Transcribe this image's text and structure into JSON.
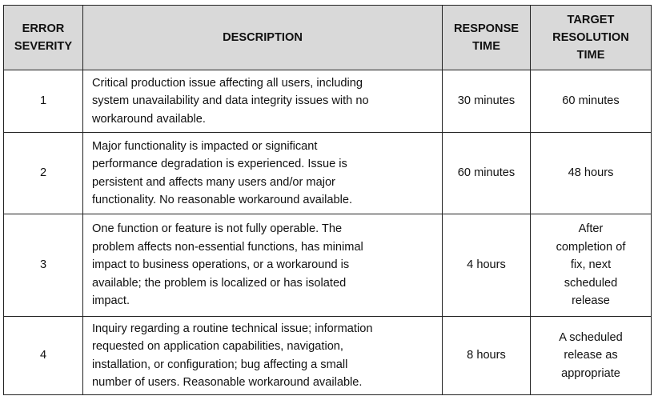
{
  "headers": {
    "severity": [
      "ERROR",
      "SEVERITY"
    ],
    "description": "DESCRIPTION",
    "response": [
      "RESPONSE",
      "TIME"
    ],
    "target": [
      "TARGET",
      "RESOLUTION",
      "TIME"
    ]
  },
  "rows": [
    {
      "severity": "1",
      "description": [
        "Critical production issue affecting all users, including",
        "system unavailability and data integrity issues with no",
        "workaround available."
      ],
      "response": "30 minutes",
      "target": [
        "60 minutes"
      ]
    },
    {
      "severity": "2",
      "description": [
        "Major functionality is impacted or significant",
        "performance degradation is experienced.  Issue is",
        "persistent and affects many users and/or major",
        "functionality.  No reasonable workaround available."
      ],
      "response": "60 minutes",
      "target": [
        "48 hours"
      ]
    },
    {
      "severity": "3",
      "description": [
        "One function or feature is not fully operable. The",
        "problem affects non-essential functions, has minimal",
        "impact to business operations, or a workaround is",
        "available; the problem is localized or has isolated",
        "impact."
      ],
      "response": "4 hours",
      "target": [
        "After",
        "completion of",
        "fix, next",
        "scheduled",
        "release"
      ]
    },
    {
      "severity": "4",
      "description": [
        "Inquiry regarding a routine technical issue; information",
        "requested on application capabilities, navigation,",
        "installation, or configuration; bug affecting a small",
        "number of users.  Reasonable workaround available."
      ],
      "response": "8 hours",
      "target": [
        "A scheduled",
        "release as",
        "appropriate"
      ]
    }
  ]
}
